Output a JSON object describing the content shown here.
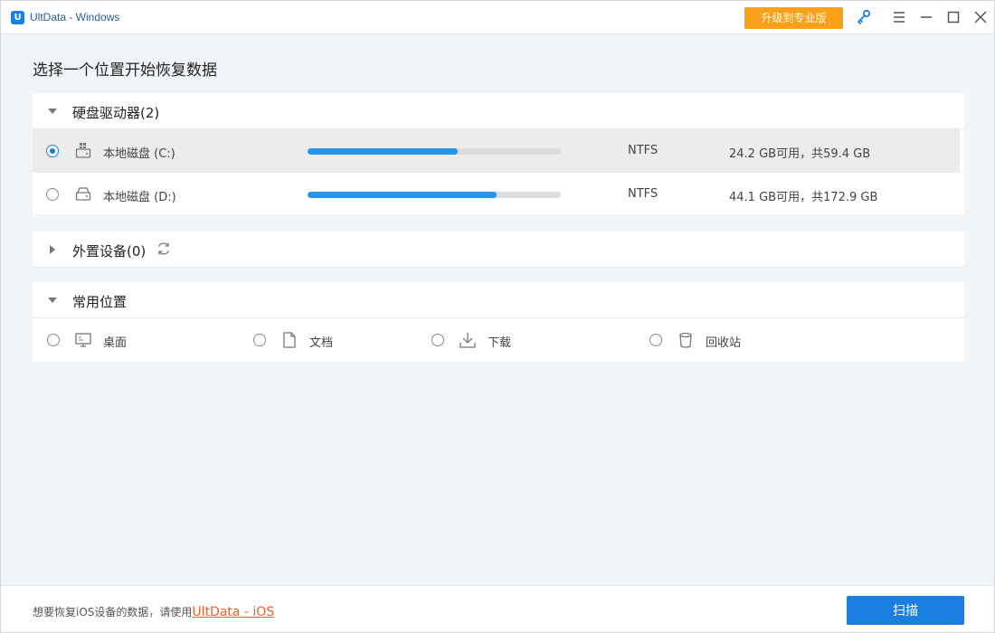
{
  "window": {
    "title": "UltData - Windows",
    "logo_letter": "U",
    "upgrade_label": "升级到专业版"
  },
  "page": {
    "title": "选择一个位置开始恢复数据"
  },
  "drives": {
    "header": "硬盘驱动器(2)",
    "items": [
      {
        "name": "本地磁盘 (C:)",
        "fs": "NTFS",
        "space": "24.2 GB可用，共59.4 GB",
        "used_fraction": 0.593,
        "selected": true
      },
      {
        "name": "本地磁盘 (D:)",
        "fs": "NTFS",
        "space": "44.1 GB可用，共172.9 GB",
        "used_fraction": 0.745,
        "selected": false
      }
    ]
  },
  "external": {
    "header": "外置设备(0)"
  },
  "common": {
    "header": "常用位置",
    "items": [
      {
        "label": "桌面",
        "icon": "monitor-icon"
      },
      {
        "label": "文档",
        "icon": "document-icon"
      },
      {
        "label": "下载",
        "icon": "download-icon"
      },
      {
        "label": "回收站",
        "icon": "trash-icon"
      }
    ]
  },
  "footer": {
    "prompt": "想要恢复iOS设备的数据，请使用",
    "link": "UltData - iOS",
    "scan_label": "扫描"
  },
  "colors": {
    "accent": "#1a7fe0",
    "upgrade": "#f8a01a",
    "link": "#f0602a",
    "bar": "#2496ee"
  }
}
